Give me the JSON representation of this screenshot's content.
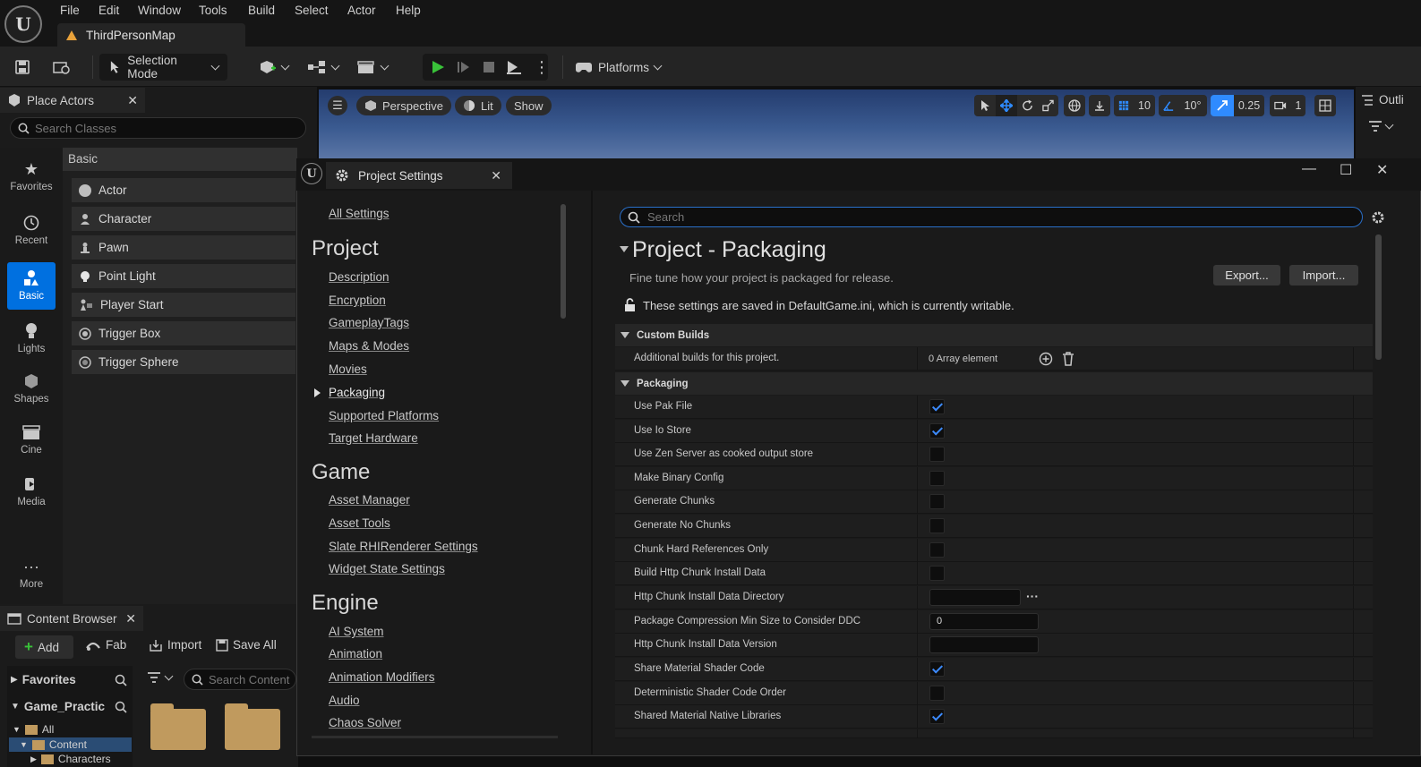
{
  "menu": {
    "items": [
      "File",
      "Edit",
      "Window",
      "Tools",
      "Build",
      "Select",
      "Actor",
      "Help"
    ],
    "logo": "U"
  },
  "doc_tab": {
    "label": "ThirdPersonMap"
  },
  "toolbar": {
    "selection_mode": "Selection Mode",
    "platforms": "Platforms"
  },
  "place_actors": {
    "tab_label": "Place Actors",
    "search_placeholder": "Search Classes",
    "category_header": "Basic",
    "categories": [
      "Favorites",
      "Recent",
      "Basic",
      "Lights",
      "Shapes",
      "Cine",
      "Media",
      "More"
    ],
    "actors": [
      "Actor",
      "Character",
      "Pawn",
      "Point Light",
      "Player Start",
      "Trigger Box",
      "Trigger Sphere"
    ]
  },
  "content_browser": {
    "tab_label": "Content Browser",
    "add": "Add",
    "fab": "Fab",
    "import": "Import",
    "save_all": "Save All",
    "favorites": "Favorites",
    "project": "Game_Practic",
    "search_placeholder": "Search Content",
    "tree": [
      "All",
      "Content",
      "Characters"
    ]
  },
  "viewport": {
    "perspective": "Perspective",
    "lit": "Lit",
    "show": "Show",
    "grid_snap": "10",
    "rot_snap": "10°",
    "scale_snap": "0.25",
    "camera_speed": "1"
  },
  "outliner": {
    "label": "Outli"
  },
  "project_settings": {
    "tab_label": "Project Settings",
    "nav": {
      "all_settings": "All Settings",
      "project_header": "Project",
      "project_items": [
        "Description",
        "Encryption",
        "GameplayTags",
        "Maps & Modes",
        "Movies",
        "Packaging",
        "Supported Platforms",
        "Target Hardware"
      ],
      "game_header": "Game",
      "game_items": [
        "Asset Manager",
        "Asset Tools",
        "Slate RHIRenderer Settings",
        "Widget State Settings"
      ],
      "engine_header": "Engine",
      "engine_items": [
        "AI System",
        "Animation",
        "Animation Modifiers",
        "Audio",
        "Chaos Solver"
      ]
    },
    "search_placeholder": "Search",
    "title": "Project - Packaging",
    "subtitle": "Fine tune how your project is packaged for release.",
    "export": "Export...",
    "import": "Import...",
    "writable_note": "These settings are saved in DefaultGame.ini, which is currently writable.",
    "custom_builds_header": "Custom Builds",
    "custom_builds_row": {
      "label": "Additional builds for this project.",
      "value": "0 Array element"
    },
    "packaging_header": "Packaging",
    "rows": [
      {
        "label": "Use Pak File",
        "type": "checkbox",
        "checked": true
      },
      {
        "label": "Use Io Store",
        "type": "checkbox",
        "checked": true
      },
      {
        "label": "Use Zen Server as cooked output store",
        "type": "checkbox",
        "checked": false
      },
      {
        "label": "Make Binary Config",
        "type": "checkbox",
        "checked": false
      },
      {
        "label": "Generate Chunks",
        "type": "checkbox",
        "checked": false
      },
      {
        "label": "Generate No Chunks",
        "type": "checkbox",
        "checked": false
      },
      {
        "label": "Chunk Hard References Only",
        "type": "checkbox",
        "checked": false
      },
      {
        "label": "Build Http Chunk Install Data",
        "type": "checkbox",
        "checked": false
      },
      {
        "label": "Http Chunk Install Data Directory",
        "type": "path",
        "value": ""
      },
      {
        "label": "Package Compression Min Size to Consider DDC",
        "type": "text",
        "value": "0"
      },
      {
        "label": "Http Chunk Install Data Version",
        "type": "text",
        "value": ""
      },
      {
        "label": "Share Material Shader Code",
        "type": "checkbox",
        "checked": true
      },
      {
        "label": "Deterministic Shader Code Order",
        "type": "checkbox",
        "checked": false
      },
      {
        "label": "Shared Material Native Libraries",
        "type": "checkbox",
        "checked": true
      }
    ]
  }
}
